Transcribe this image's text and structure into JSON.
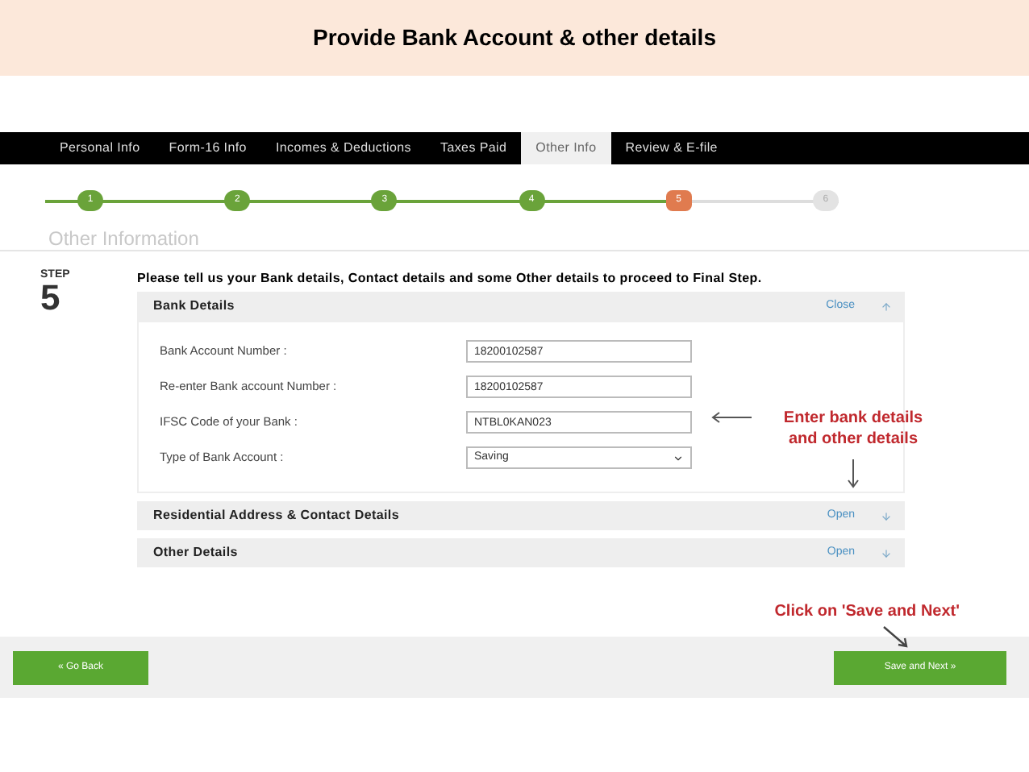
{
  "slide_title": "Provide Bank Account & other details",
  "tabs": [
    {
      "label": "Personal Info",
      "selected": false
    },
    {
      "label": "Form-16 Info",
      "selected": false
    },
    {
      "label": "Incomes & Deductions",
      "selected": false
    },
    {
      "label": "Taxes Paid",
      "selected": false
    },
    {
      "label": "Other Info",
      "selected": true
    },
    {
      "label": "Review & E-file",
      "selected": false
    }
  ],
  "steps": [
    {
      "label": "1",
      "kind": "done"
    },
    {
      "label": "2",
      "kind": "done"
    },
    {
      "label": "3",
      "kind": "done"
    },
    {
      "label": "4",
      "kind": "done"
    },
    {
      "label": "5",
      "kind": "current"
    },
    {
      "label": "6",
      "kind": "pending"
    }
  ],
  "section_title": "Other Information",
  "step_badge": {
    "label": "STEP",
    "number": "5"
  },
  "instruction": "Please tell us your Bank details, Contact details and some Other details to proceed to Final Step.",
  "panels": [
    {
      "title": "Bank Details",
      "action": "Close",
      "expanded": true,
      "fields": [
        {
          "label": "Bank Account Number :",
          "value": "18200102587",
          "kind": "text"
        },
        {
          "label": "Re-enter Bank account Number :",
          "value": "18200102587",
          "kind": "text"
        },
        {
          "label": "IFSC Code of your Bank :",
          "value": "NTBL0KAN023",
          "kind": "text"
        },
        {
          "label": "Type of Bank Account :",
          "value": "Saving",
          "kind": "select"
        }
      ]
    },
    {
      "title": "Residential Address & Contact Details",
      "action": "Open",
      "expanded": false
    },
    {
      "title": "Other Details",
      "action": "Open",
      "expanded": false
    }
  ],
  "annotations": [
    {
      "text": "Enter bank details and other details"
    },
    {
      "text": "Click on 'Save and Next'"
    }
  ],
  "buttons": [
    {
      "label": "« Go Back"
    },
    {
      "label": "Save and Next »"
    }
  ]
}
